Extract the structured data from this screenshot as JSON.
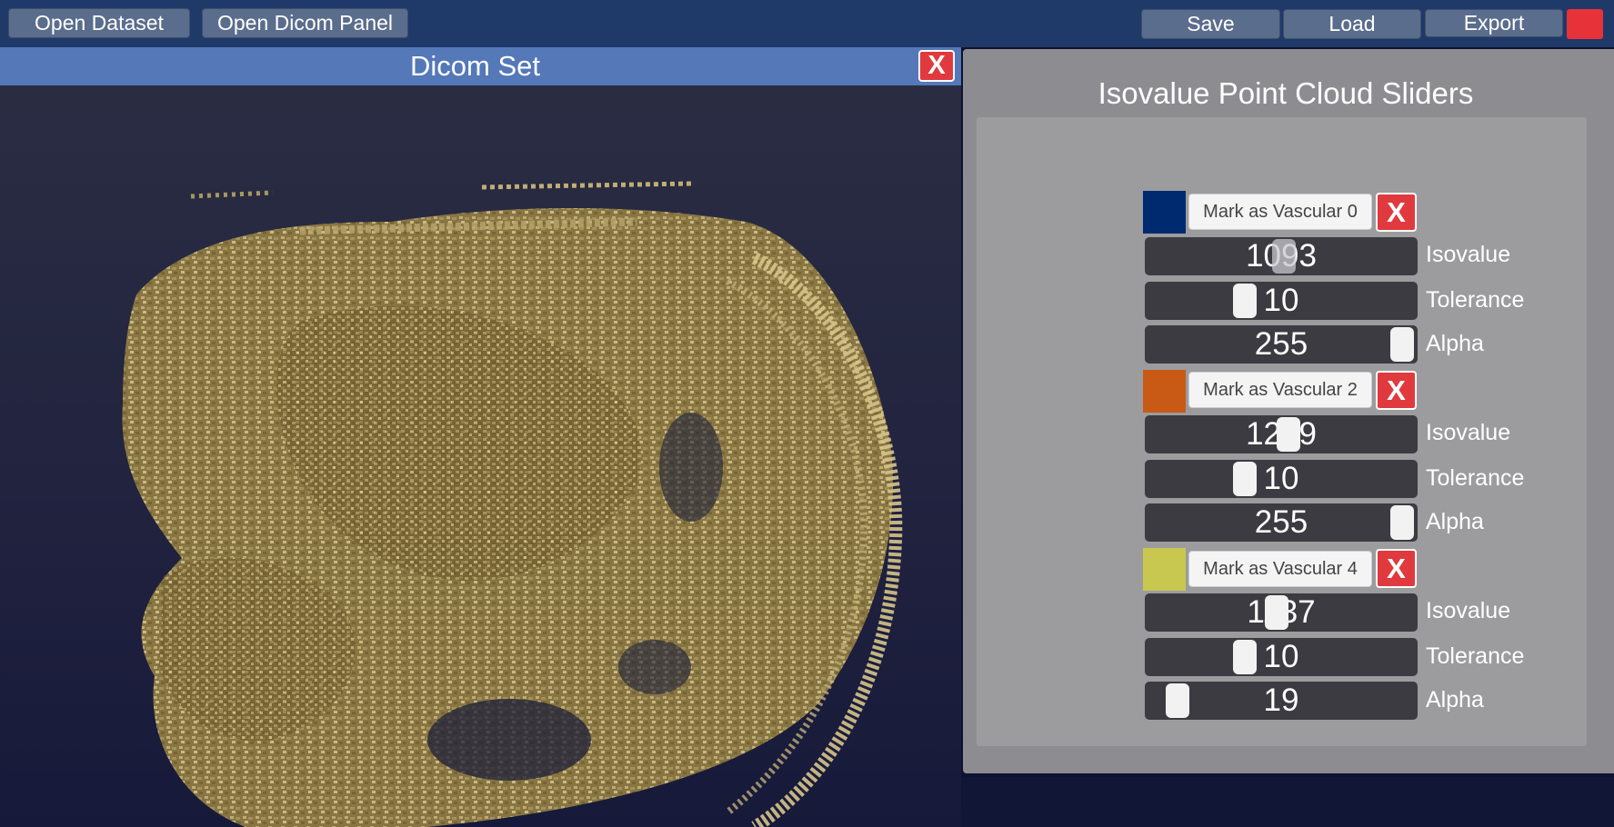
{
  "toolbar": {
    "open_dataset": "Open Dataset",
    "open_dicom_panel": "Open Dicom Panel",
    "save": "Save",
    "load": "Load",
    "export": "Export"
  },
  "dicom_window": {
    "title": "Dicom Set",
    "close": "X"
  },
  "slider_panel": {
    "title": "Isovalue Point Cloud Sliders",
    "groups": [
      {
        "color": "#002a70",
        "mark_label": "Mark as Vascular 0",
        "remove": "X",
        "sliders": [
          {
            "label": "Isovalue",
            "value": "1093",
            "level": 0.51
          },
          {
            "label": "Tolerance",
            "value": "10",
            "level": 0.35
          },
          {
            "label": "Alpha",
            "value": "255",
            "level": 1.0
          }
        ]
      },
      {
        "color": "#c85a16",
        "mark_label": "Mark as Vascular 2",
        "remove": "X",
        "sliders": [
          {
            "label": "Isovalue",
            "value": "1279",
            "level": 0.53
          },
          {
            "label": "Tolerance",
            "value": "10",
            "level": 0.35
          },
          {
            "label": "Alpha",
            "value": "255",
            "level": 1.0
          }
        ]
      },
      {
        "color": "#c8c850",
        "mark_label": "Mark as Vascular 4",
        "remove": "X",
        "sliders": [
          {
            "label": "Isovalue",
            "value": "1137",
            "level": 0.48
          },
          {
            "label": "Tolerance",
            "value": "10",
            "level": 0.35
          },
          {
            "label": "Alpha",
            "value": "19",
            "level": 0.07
          }
        ]
      }
    ]
  }
}
